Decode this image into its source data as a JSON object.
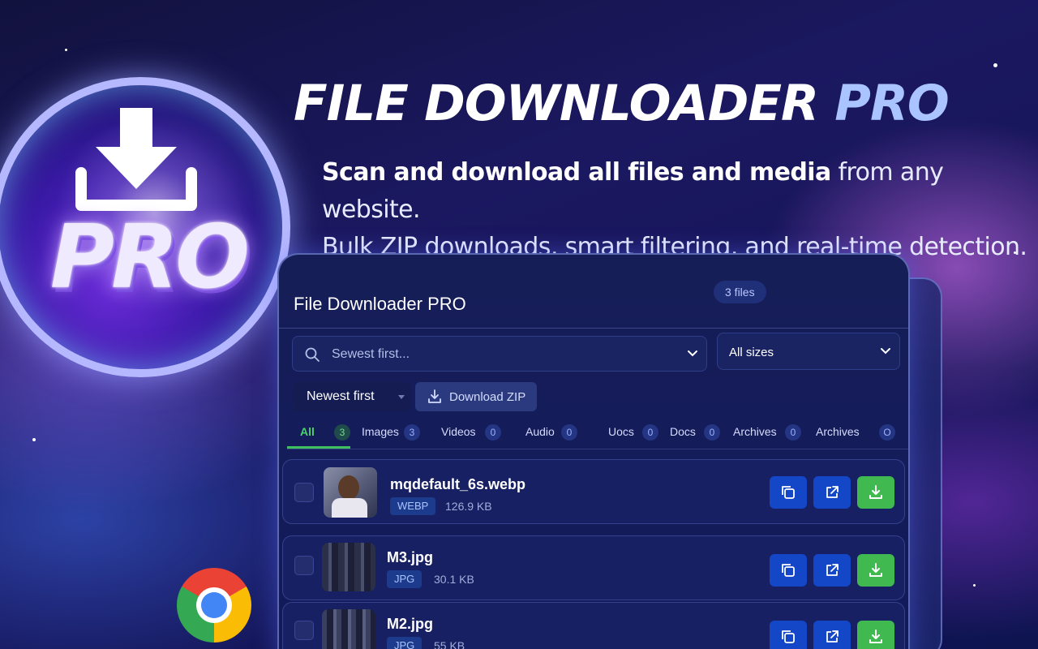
{
  "hero": {
    "logo_text": "PRO",
    "logo_icon": "download-arrow-icon",
    "headline_main": "FILE DOWNLOADER ",
    "headline_accent": "PRO",
    "subline_bold": "Scan and download all files and media",
    "subline_rest": " from any website.",
    "subline_line2": "Bulk ZIP downloads, smart filtering, and real-time detection.",
    "browser_icon": "chrome-icon"
  },
  "panel": {
    "title": "File Downloader PRO",
    "file_count": "3 files",
    "search_placeholder": "Sewest first...",
    "size_filter": "All sizes",
    "sort_value": "Newest first",
    "download_zip_label": "Download ZIP",
    "tabs": [
      {
        "label": "All",
        "count": "3"
      },
      {
        "label": "Images",
        "count": "3"
      },
      {
        "label": "Videos",
        "count": "0"
      },
      {
        "label": "Audio",
        "count": "0"
      },
      {
        "label": "Uocs",
        "count": "0"
      },
      {
        "label": "Docs",
        "count": "0"
      },
      {
        "label": "Archives",
        "count": "0"
      },
      {
        "label": "Archives",
        "count": "O"
      }
    ],
    "files": [
      {
        "name": "mqdefault_6s.webp",
        "type": "WEBP",
        "size": "126.9 KB"
      },
      {
        "name": "M3.jpg",
        "type": "JPG",
        "size": "30.1 KB"
      },
      {
        "name": "M2.jpg",
        "type": "JPG",
        "size": "55 KB"
      }
    ],
    "actions": {
      "copy_icon": "copy-icon",
      "open_icon": "external-link-icon",
      "download_icon": "download-icon"
    }
  },
  "colors": {
    "accent_blue": "#1447c8",
    "download_green": "#3fb950",
    "active_tab": "#49d36a",
    "headline_accent": "#a9c4ff"
  }
}
